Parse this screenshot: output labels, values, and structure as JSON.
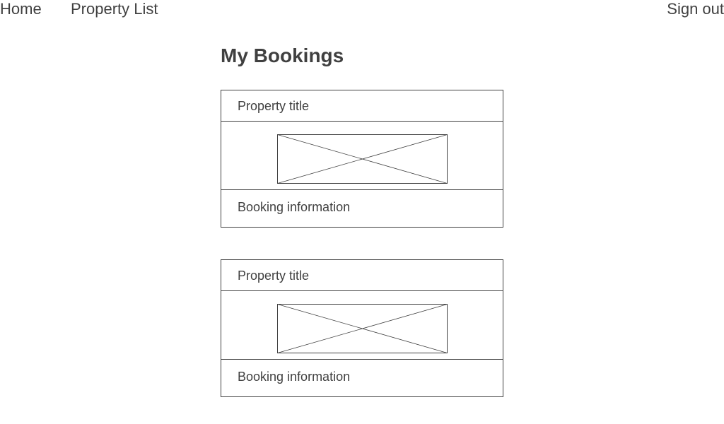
{
  "nav": {
    "home_label": "Home",
    "property_list_label": "Property List",
    "sign_out_label": "Sign out"
  },
  "page": {
    "title": "My Bookings"
  },
  "bookings": [
    {
      "property_title": "Property title",
      "booking_info": "Booking information",
      "image_icon": "image-placeholder-icon"
    },
    {
      "property_title": "Property title",
      "booking_info": "Booking information",
      "image_icon": "image-placeholder-icon"
    }
  ],
  "colors": {
    "text": "#404040",
    "border": "#404040",
    "background": "#ffffff"
  }
}
